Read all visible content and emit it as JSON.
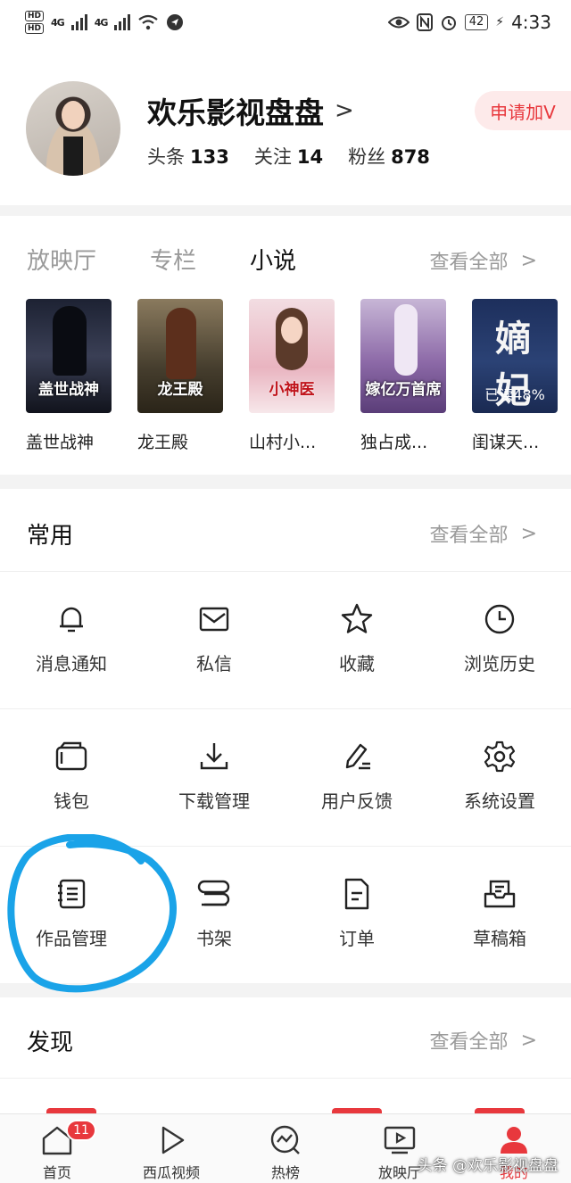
{
  "status_bar": {
    "network_left": "4G",
    "network_right": "4G",
    "battery": "42",
    "time": "4:33"
  },
  "profile": {
    "name": "欢乐影视盘盘",
    "stats": [
      {
        "label": "头条",
        "value": "133"
      },
      {
        "label": "关注",
        "value": "14"
      },
      {
        "label": "粉丝",
        "value": "878"
      }
    ],
    "apply_button": "申请加V"
  },
  "media": {
    "tabs": [
      "放映厅",
      "专栏",
      "小说"
    ],
    "active_tab": "小说",
    "see_all": "查看全部",
    "books": [
      {
        "title": "盖世战神",
        "cover_text": "盖世战神"
      },
      {
        "title": "龙王殿",
        "cover_text": "龙王殿"
      },
      {
        "title": "山村小...",
        "cover_text": "小神医"
      },
      {
        "title": "独占成...",
        "cover_text": "嫁亿万首席"
      },
      {
        "title": "闺谋天...",
        "cover_text": "嫡妃",
        "read_progress": "已读48%"
      }
    ]
  },
  "common": {
    "title": "常用",
    "see_all": "查看全部",
    "items": [
      {
        "label": "消息通知",
        "icon": "bell-icon"
      },
      {
        "label": "私信",
        "icon": "mail-icon"
      },
      {
        "label": "收藏",
        "icon": "star-icon"
      },
      {
        "label": "浏览历史",
        "icon": "clock-icon"
      },
      {
        "label": "钱包",
        "icon": "wallet-icon"
      },
      {
        "label": "下载管理",
        "icon": "download-icon"
      },
      {
        "label": "用户反馈",
        "icon": "pen-icon"
      },
      {
        "label": "系统设置",
        "icon": "gear-icon"
      },
      {
        "label": "作品管理",
        "icon": "notebook-icon"
      },
      {
        "label": "书架",
        "icon": "bookshelf-icon"
      },
      {
        "label": "订单",
        "icon": "document-icon"
      },
      {
        "label": "草稿箱",
        "icon": "draft-box-icon"
      }
    ]
  },
  "discover": {
    "title": "发现",
    "see_all": "查看全部"
  },
  "bottom_nav": {
    "items": [
      {
        "label": "首页",
        "badge": "11"
      },
      {
        "label": "西瓜视频"
      },
      {
        "label": "热榜"
      },
      {
        "label": "放映厅"
      },
      {
        "label": "我的"
      }
    ]
  },
  "watermark": "头条 @欢乐影视盘盘",
  "colors": {
    "accent": "#e8383d",
    "annotation": "#1aa3e8"
  }
}
